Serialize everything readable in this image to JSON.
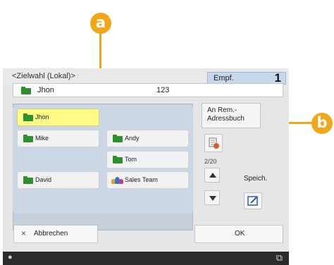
{
  "callouts": {
    "a": "a",
    "b": "b"
  },
  "header": {
    "title": "<Zielwahl (Lokal)>",
    "recipient_label": "Empf.",
    "recipient_count": "1"
  },
  "selected": {
    "name": "Jhon",
    "number": "123"
  },
  "entries": [
    {
      "label": "Jhon",
      "icon": "folder-icon",
      "selected": true
    },
    {
      "label": "Mike",
      "icon": "folder-icon",
      "selected": false
    },
    {
      "label": "Andy",
      "icon": "folder-icon",
      "selected": false
    },
    {
      "label": "Tom",
      "icon": "folder-icon",
      "selected": false
    },
    {
      "label": "David",
      "icon": "folder-icon",
      "selected": false
    },
    {
      "label": "Sales Team",
      "icon": "group-icon",
      "selected": false
    }
  ],
  "side": {
    "remote_button": "An Rem.-\nAdressbuch",
    "page": "2/20",
    "up_icon": "arrow-up-icon",
    "down_icon": "arrow-down-icon",
    "store_label": "Speich.",
    "store_icon": "edit-icon",
    "detail_icon": "address-detail-icon"
  },
  "footer": {
    "cancel_label": "Abbrechen",
    "ok_label": "OK"
  },
  "status": {
    "left_icon": "status-icon",
    "right_icon": "network-icon"
  },
  "colors": {
    "accent": "#f2a619",
    "selected_bg": "#fdfa88",
    "header_box": "#c6d8ec",
    "folder": "#2f8f2f"
  }
}
